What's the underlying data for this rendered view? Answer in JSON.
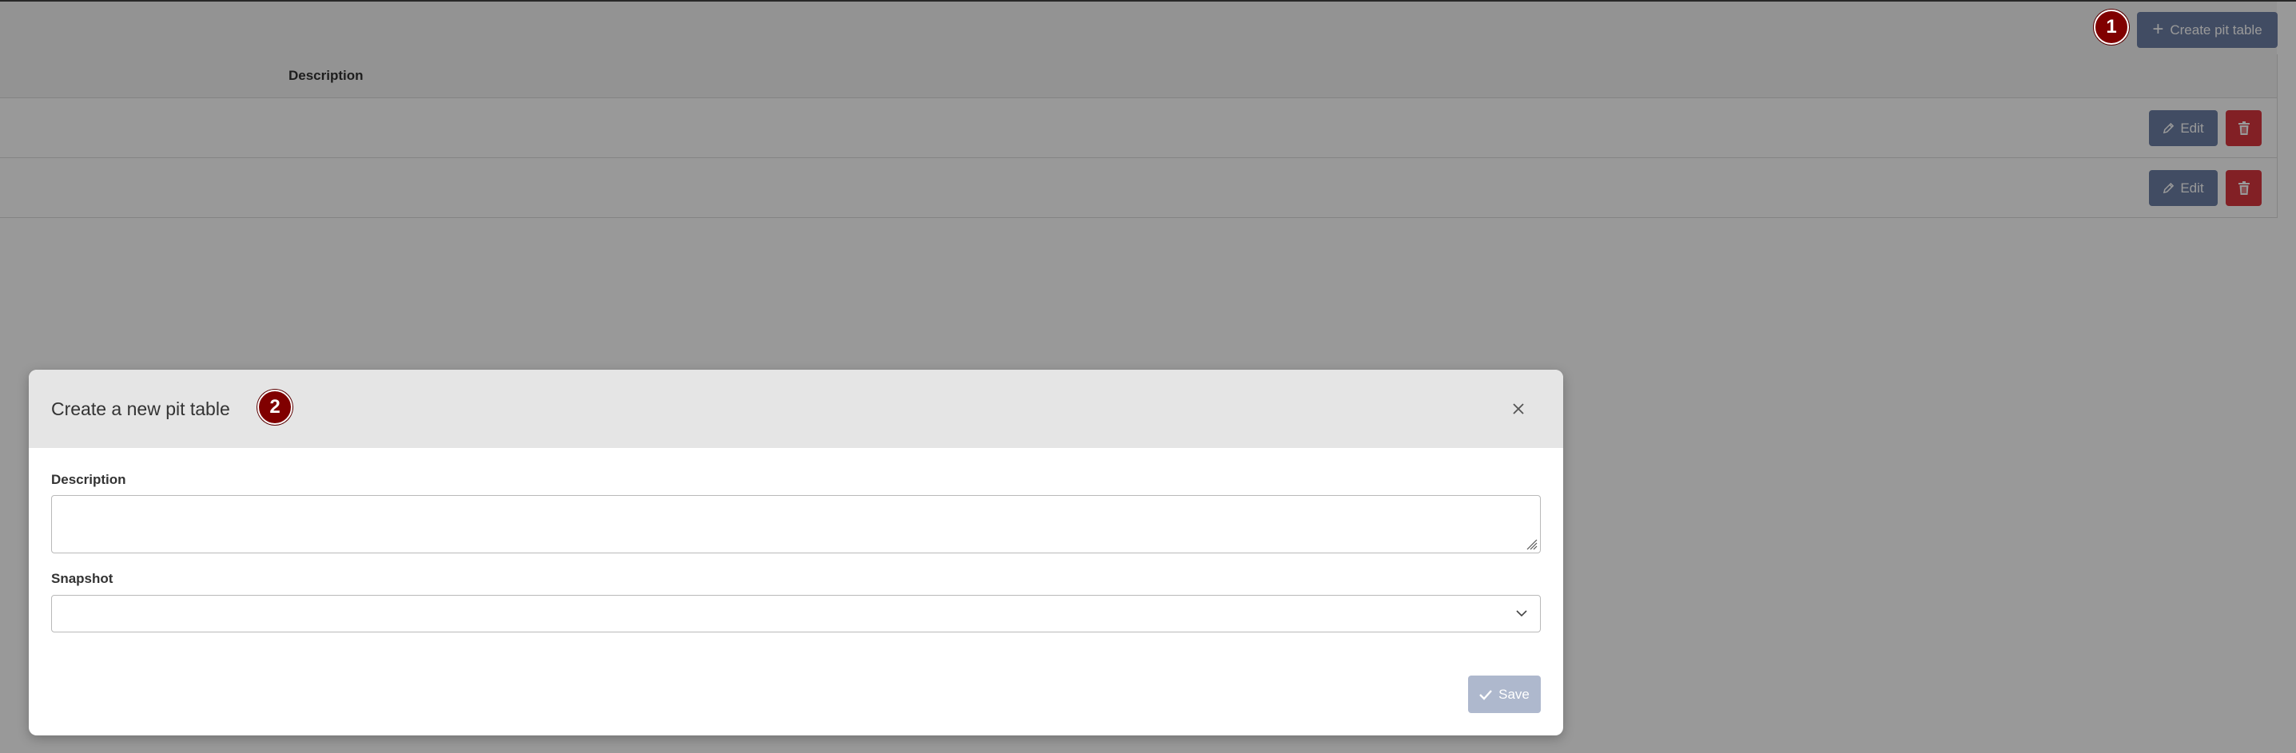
{
  "toolbar": {
    "create_label": "Create pit table",
    "create_icon": "plus-icon"
  },
  "table": {
    "columns": [
      "Description"
    ],
    "rows": [
      {
        "description": "",
        "edit_label": "Edit"
      },
      {
        "description": "",
        "edit_label": "Edit"
      }
    ]
  },
  "annotations": {
    "badge_1": "1",
    "badge_2": "2",
    "badge_color": "#800000"
  },
  "modal": {
    "title": "Create a new pit table",
    "description_label": "Description",
    "description_value": "",
    "snapshot_label": "Snapshot",
    "snapshot_value": "",
    "save_label": "Save"
  },
  "colors": {
    "primary_button": "#6d7fa5",
    "danger_button": "#d9363e",
    "overlay": "rgba(0,0,0,0.4)"
  }
}
